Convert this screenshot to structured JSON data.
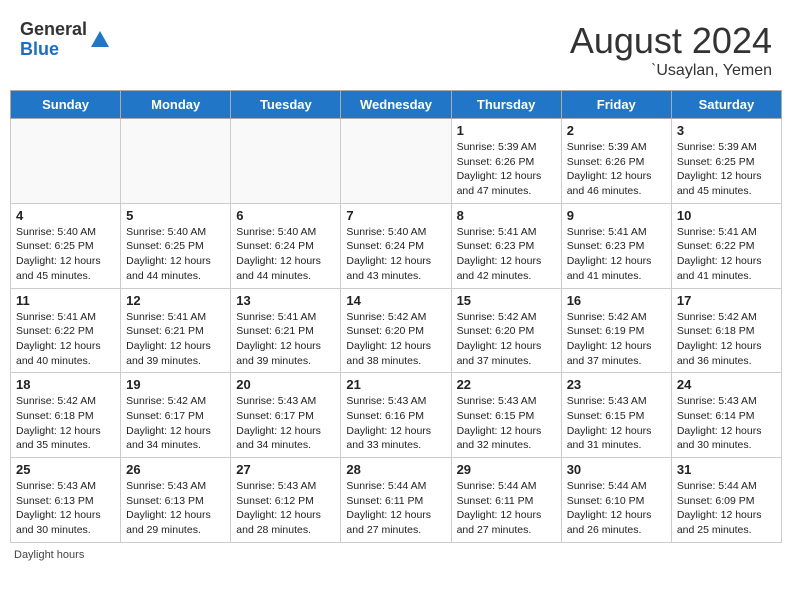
{
  "header": {
    "logo_general": "General",
    "logo_blue": "Blue",
    "month_year": "August 2024",
    "location": "`Usaylan, Yemen"
  },
  "weekdays": [
    "Sunday",
    "Monday",
    "Tuesday",
    "Wednesday",
    "Thursday",
    "Friday",
    "Saturday"
  ],
  "footer": {
    "daylight_label": "Daylight hours"
  },
  "weeks": [
    [
      {
        "day": "",
        "info": ""
      },
      {
        "day": "",
        "info": ""
      },
      {
        "day": "",
        "info": ""
      },
      {
        "day": "",
        "info": ""
      },
      {
        "day": "1",
        "info": "Sunrise: 5:39 AM\nSunset: 6:26 PM\nDaylight: 12 hours and 47 minutes."
      },
      {
        "day": "2",
        "info": "Sunrise: 5:39 AM\nSunset: 6:26 PM\nDaylight: 12 hours and 46 minutes."
      },
      {
        "day": "3",
        "info": "Sunrise: 5:39 AM\nSunset: 6:25 PM\nDaylight: 12 hours and 45 minutes."
      }
    ],
    [
      {
        "day": "4",
        "info": "Sunrise: 5:40 AM\nSunset: 6:25 PM\nDaylight: 12 hours and 45 minutes."
      },
      {
        "day": "5",
        "info": "Sunrise: 5:40 AM\nSunset: 6:25 PM\nDaylight: 12 hours and 44 minutes."
      },
      {
        "day": "6",
        "info": "Sunrise: 5:40 AM\nSunset: 6:24 PM\nDaylight: 12 hours and 44 minutes."
      },
      {
        "day": "7",
        "info": "Sunrise: 5:40 AM\nSunset: 6:24 PM\nDaylight: 12 hours and 43 minutes."
      },
      {
        "day": "8",
        "info": "Sunrise: 5:41 AM\nSunset: 6:23 PM\nDaylight: 12 hours and 42 minutes."
      },
      {
        "day": "9",
        "info": "Sunrise: 5:41 AM\nSunset: 6:23 PM\nDaylight: 12 hours and 41 minutes."
      },
      {
        "day": "10",
        "info": "Sunrise: 5:41 AM\nSunset: 6:22 PM\nDaylight: 12 hours and 41 minutes."
      }
    ],
    [
      {
        "day": "11",
        "info": "Sunrise: 5:41 AM\nSunset: 6:22 PM\nDaylight: 12 hours and 40 minutes."
      },
      {
        "day": "12",
        "info": "Sunrise: 5:41 AM\nSunset: 6:21 PM\nDaylight: 12 hours and 39 minutes."
      },
      {
        "day": "13",
        "info": "Sunrise: 5:41 AM\nSunset: 6:21 PM\nDaylight: 12 hours and 39 minutes."
      },
      {
        "day": "14",
        "info": "Sunrise: 5:42 AM\nSunset: 6:20 PM\nDaylight: 12 hours and 38 minutes."
      },
      {
        "day": "15",
        "info": "Sunrise: 5:42 AM\nSunset: 6:20 PM\nDaylight: 12 hours and 37 minutes."
      },
      {
        "day": "16",
        "info": "Sunrise: 5:42 AM\nSunset: 6:19 PM\nDaylight: 12 hours and 37 minutes."
      },
      {
        "day": "17",
        "info": "Sunrise: 5:42 AM\nSunset: 6:18 PM\nDaylight: 12 hours and 36 minutes."
      }
    ],
    [
      {
        "day": "18",
        "info": "Sunrise: 5:42 AM\nSunset: 6:18 PM\nDaylight: 12 hours and 35 minutes."
      },
      {
        "day": "19",
        "info": "Sunrise: 5:42 AM\nSunset: 6:17 PM\nDaylight: 12 hours and 34 minutes."
      },
      {
        "day": "20",
        "info": "Sunrise: 5:43 AM\nSunset: 6:17 PM\nDaylight: 12 hours and 34 minutes."
      },
      {
        "day": "21",
        "info": "Sunrise: 5:43 AM\nSunset: 6:16 PM\nDaylight: 12 hours and 33 minutes."
      },
      {
        "day": "22",
        "info": "Sunrise: 5:43 AM\nSunset: 6:15 PM\nDaylight: 12 hours and 32 minutes."
      },
      {
        "day": "23",
        "info": "Sunrise: 5:43 AM\nSunset: 6:15 PM\nDaylight: 12 hours and 31 minutes."
      },
      {
        "day": "24",
        "info": "Sunrise: 5:43 AM\nSunset: 6:14 PM\nDaylight: 12 hours and 30 minutes."
      }
    ],
    [
      {
        "day": "25",
        "info": "Sunrise: 5:43 AM\nSunset: 6:13 PM\nDaylight: 12 hours and 30 minutes."
      },
      {
        "day": "26",
        "info": "Sunrise: 5:43 AM\nSunset: 6:13 PM\nDaylight: 12 hours and 29 minutes."
      },
      {
        "day": "27",
        "info": "Sunrise: 5:43 AM\nSunset: 6:12 PM\nDaylight: 12 hours and 28 minutes."
      },
      {
        "day": "28",
        "info": "Sunrise: 5:44 AM\nSunset: 6:11 PM\nDaylight: 12 hours and 27 minutes."
      },
      {
        "day": "29",
        "info": "Sunrise: 5:44 AM\nSunset: 6:11 PM\nDaylight: 12 hours and 27 minutes."
      },
      {
        "day": "30",
        "info": "Sunrise: 5:44 AM\nSunset: 6:10 PM\nDaylight: 12 hours and 26 minutes."
      },
      {
        "day": "31",
        "info": "Sunrise: 5:44 AM\nSunset: 6:09 PM\nDaylight: 12 hours and 25 minutes."
      }
    ]
  ]
}
